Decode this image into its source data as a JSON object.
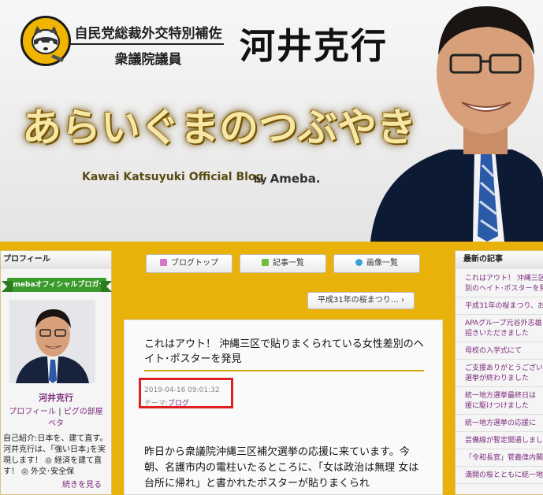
{
  "header": {
    "party_title": "自民党総裁外交特別補佐",
    "house_title": "衆議院議員",
    "politician_name": "河井克行",
    "blog_title": "あらいぐまのつぶやき",
    "blog_subtitle": "Kawai Katsuyuki Official Blog",
    "ameba_by": "by",
    "ameba_brand": "Ameba."
  },
  "nav": {
    "blog_top": "ブログトップ",
    "article_list": "記事一覧",
    "image_list": "画像一覧",
    "prev_post": "平成31年の桜まつり… ›"
  },
  "sidebar_left": {
    "heading": "プロフィール",
    "official_badge": "Amebaオフィシャルブロガー",
    "name": "河井克行",
    "link_profile": "プロフィール",
    "separator": "|",
    "link_pig": "ピグの部屋",
    "link_beta": "ベタ",
    "intro": "自己紹介:日本を、建て直す。河井克行は、｢強い日本｣を実現します！ ◎ 経済を建て直す！ ◎ 外交･安全保",
    "read_more": "続きを見る"
  },
  "article": {
    "title": "これはアウト！ 沖縄三区で貼りまくられている女性差別のヘイト･ポスターを発見",
    "date": "2019-04-16 09:01:32",
    "theme_label": "テーマ:",
    "theme_link": "ブログ",
    "body": "昨日から衆議院沖縄三区補欠選挙の応援に来ています。今朝、名護市内の電柱いたるところに、「女は政治は無理 女は台所に帰れ」と書かれたポスターが貼りまくられ"
  },
  "sidebar_right": {
    "heading": "最新の記事",
    "items": [
      "これはアウト！ 沖縄三区\n別のヘイト･ポスターを発",
      "平成31年の桜まつり、お",
      "APAグループ元谷外志雄\n招きいただきました",
      "母校の入学式にて",
      "ご支援ありがとうござい\n選挙が終わりました",
      "統一地方選挙最終日は\n援に駆けつけました",
      "統一地方選挙の応援に",
      "芸備線が暫定開通しまし",
      "「令和長官」菅義偉内閣",
      "満開の桜とともに統一地"
    ]
  },
  "colors": {
    "page_background": "#e8b20a",
    "accent_link": "#7b2a7b",
    "badge_green": "#3a9a2a",
    "highlight_red": "#e02020"
  }
}
